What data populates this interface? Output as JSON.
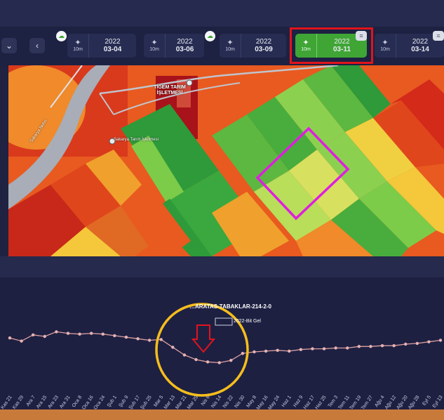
{
  "toolbar": {
    "prev_icon": "chevron-left-icon",
    "tiles": [
      {
        "year": "2022",
        "date": "03-04",
        "resolution": "10m",
        "active": false
      },
      {
        "year": "2022",
        "date": "03-06",
        "resolution": "10m",
        "active": false
      },
      {
        "year": "2022",
        "date": "03-09",
        "resolution": "10m",
        "active": false
      },
      {
        "year": "2022",
        "date": "03-11",
        "resolution": "10m",
        "active": true
      },
      {
        "year": "2022",
        "date": "03-14",
        "resolution": "10m",
        "active": false
      }
    ]
  },
  "map": {
    "labels": [
      "TİGEM TARIM İŞLETMESİ",
      "Sakarya Tarım İşletmesi",
      "Sakarya Nehri"
    ]
  },
  "chart_data": {
    "type": "line",
    "title": "…ARATAS-TABAKLAR-214-2-0",
    "series": [
      {
        "name": "2022-Bit Gel"
      }
    ],
    "categories": [
      "Kas 21",
      "Kas 29",
      "Ara 7",
      "Ara 15",
      "Ara 23",
      "Ara 31",
      "Oca 8",
      "Oca 16",
      "Oca 24",
      "Şub 1",
      "Şub 9",
      "Şub 17",
      "Şub 25",
      "Mar 5",
      "Mar 13",
      "Mar 21",
      "Mar 29",
      "Nis 6",
      "Nis 14",
      "Nis 22",
      "Nis 30",
      "May 8",
      "May 16",
      "May 24",
      "Haz 1",
      "Haz 9",
      "Haz 17",
      "Haz 25",
      "Tem 3",
      "Tem 11",
      "Tem 19",
      "Tem 27",
      "Ağu 4",
      "Ağu 12",
      "Ağu 20",
      "Ağu 28",
      "Eyl 5",
      "Eyl 13"
    ],
    "values": [
      0.58,
      0.54,
      0.62,
      0.6,
      0.66,
      0.64,
      0.63,
      0.64,
      0.63,
      0.61,
      0.59,
      0.57,
      0.55,
      0.56,
      0.46,
      0.36,
      0.3,
      0.27,
      0.26,
      0.29,
      0.38,
      0.4,
      0.41,
      0.42,
      0.41,
      0.43,
      0.44,
      0.44,
      0.45,
      0.45,
      0.47,
      0.47,
      0.48,
      0.48,
      0.5,
      0.51,
      0.53,
      0.55
    ],
    "ylim": [
      0,
      1
    ],
    "colors": {
      "line": "#d9a0a0",
      "marker": "#e7b3b3",
      "annotation_circle": "#f5be1c",
      "arrow": "#e1141c"
    }
  }
}
